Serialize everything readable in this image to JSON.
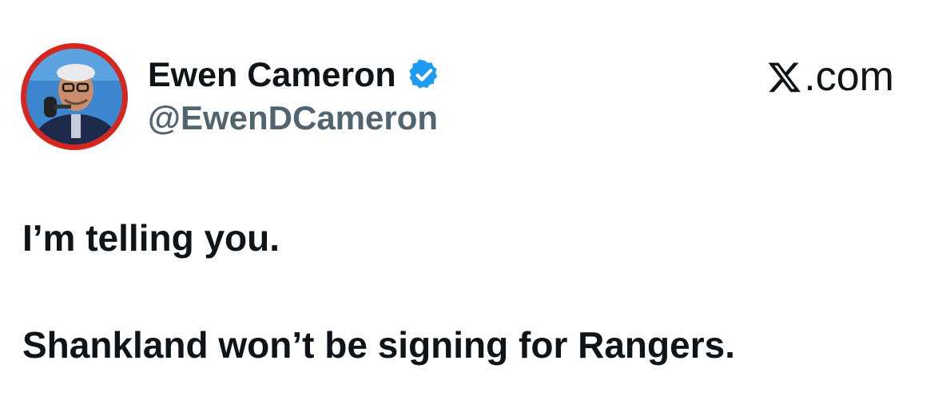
{
  "author": {
    "display_name": "Ewen Cameron",
    "handle": "@EwenDCameron",
    "verified": true,
    "avatar_border_color": "#d7261e"
  },
  "site": {
    "label": ".com",
    "logo_icon": "x-logo-icon"
  },
  "tweet": {
    "lines": [
      "I’m telling you.",
      "Shankland won’t be signing for Rangers."
    ]
  },
  "colors": {
    "text_primary": "#0f1419",
    "text_secondary": "#536471",
    "verified_badge": "#1d9bf0"
  }
}
